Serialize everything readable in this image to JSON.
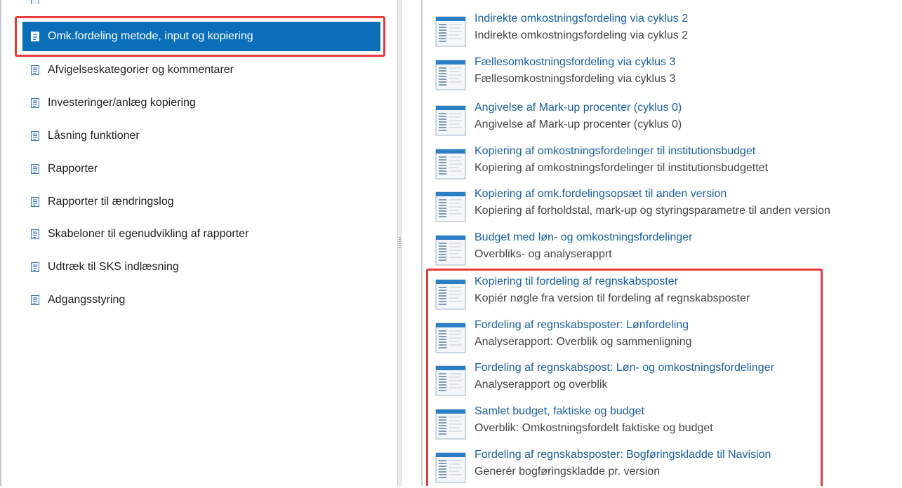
{
  "left_nav": {
    "items": [
      {
        "label": "Omk.fordeling metode, input og kopiering",
        "selected": true
      },
      {
        "label": "Afvigelseskategorier og kommentarer"
      },
      {
        "label": "Investeringer/anlæg kopiering"
      },
      {
        "label": "Låsning funktioner"
      },
      {
        "label": "Rapporter"
      },
      {
        "label": "Rapporter til ændringslog"
      },
      {
        "label": "Skabeloner til egenudvikling af rapporter"
      },
      {
        "label": "Udtræk til SKS indlæsning"
      },
      {
        "label": "Adgangsstyring"
      }
    ]
  },
  "reports": [
    {
      "title": "Indirekte omkostningsfordeling via cyklus 2",
      "subtitle": "Indirekte omkostningsfordeling via cyklus 2"
    },
    {
      "title": "Fællesomkostningsfordeling via cyklus 3",
      "subtitle": "Fællesomkostningsfordeling via cyklus 3"
    },
    {
      "title": "Angivelse af Mark-up procenter (cyklus 0)",
      "subtitle": "Angivelse af Mark-up procenter (cyklus 0)"
    },
    {
      "title": "Kopiering af omkostningsfordelinger til institutionsbudget",
      "subtitle": "Kopiering af omkostningsfordelinger til institutionsbudgettet"
    },
    {
      "title": "Kopiering af omk.fordelingsopsæt til anden version",
      "subtitle": "Kopiering af forholdstal, mark-up og styringsparametre til anden version"
    },
    {
      "title": "Budget med løn- og omkostningsfordelinger",
      "subtitle": "Overbliks- og analyserapprt"
    },
    {
      "title": "Kopiering til fordeling af regnskabsposter",
      "subtitle": "Kopiér nøgle fra version til fordeling af regnskabsposter"
    },
    {
      "title": "Fordeling af regnskabsposter: Lønfordeling",
      "subtitle": "Analyserapport: Overblik og sammenligning"
    },
    {
      "title": "Fordeling af regnskabspost: Løn- og omkostningsfordelinger",
      "subtitle": "Analyserapport og overblik"
    },
    {
      "title": "Samlet budget, faktiske og budget",
      "subtitle": "Overblik: Omkostningsfordelt faktiske og budget"
    },
    {
      "title": "Fordeling af regnskabsposter: Bogføringskladde til Navision",
      "subtitle": "Generér bogføringskladde pr. version"
    }
  ],
  "colors": {
    "selected_bg": "#0a6fb8",
    "link": "#1a5fa0",
    "highlight": "#e63b3b"
  },
  "icons": {
    "nav": "document-icon",
    "report": "report-icon"
  }
}
